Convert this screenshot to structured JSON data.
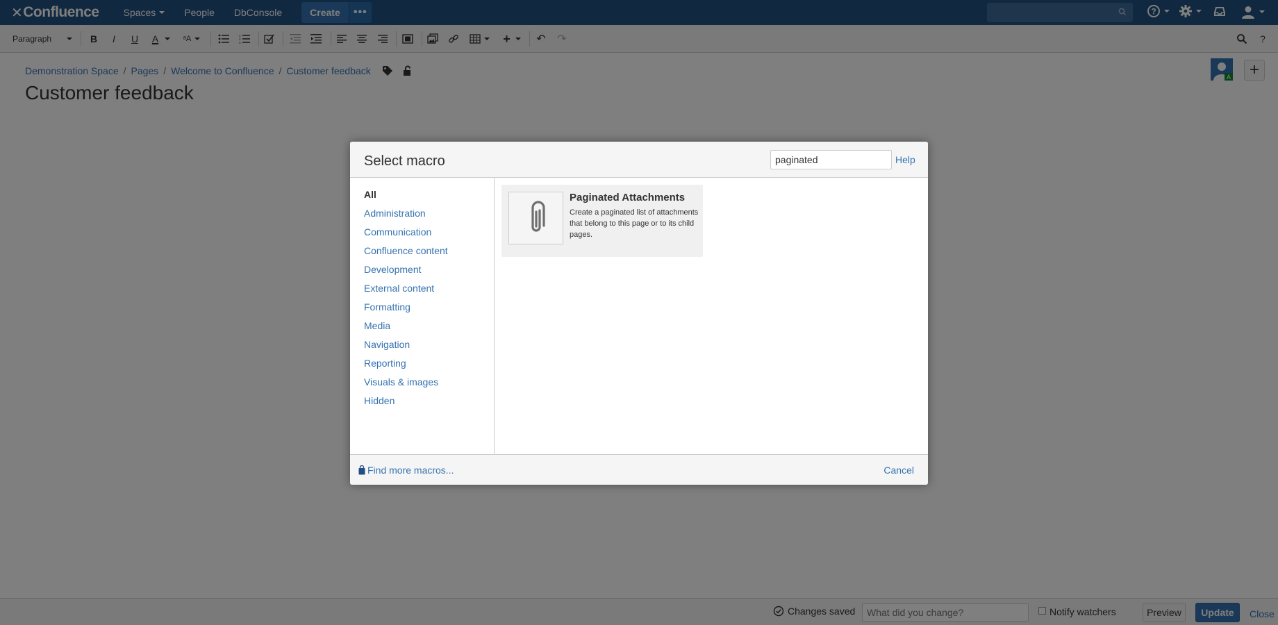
{
  "topnav": {
    "logo_text": "Confluence",
    "items": [
      "Spaces",
      "People",
      "DbConsole"
    ],
    "create_label": "Create",
    "more_label": "•••"
  },
  "toolbar": {
    "paragraph_label": "Paragraph",
    "bold": "B",
    "italic": "I",
    "underline": "U",
    "text_color": "A"
  },
  "breadcrumb": [
    "Demonstration Space",
    "Pages",
    "Welcome to Confluence",
    "Customer feedback"
  ],
  "page": {
    "title": "Customer feedback"
  },
  "dialog": {
    "title": "Select macro",
    "search_value": "paginated",
    "help_label": "Help",
    "categories": [
      "All",
      "Administration",
      "Communication",
      "Confluence content",
      "Development",
      "External content",
      "Formatting",
      "Media",
      "Navigation",
      "Reporting",
      "Visuals & images",
      "Hidden"
    ],
    "active_category": "All",
    "macro": {
      "name": "Paginated Attachments",
      "description": "Create a paginated list of attachments that belong to this page or to its child pages."
    },
    "find_more_label": "Find more macros...",
    "cancel_label": "Cancel"
  },
  "footer": {
    "changes_saved": "Changes saved",
    "change_placeholder": "What did you change?",
    "notify_label": "Notify watchers",
    "preview_label": "Preview",
    "update_label": "Update",
    "close_label": "Close"
  },
  "colors": {
    "nav_bg": "#205081",
    "link": "#3572b0",
    "button_primary": "#3572b0"
  }
}
